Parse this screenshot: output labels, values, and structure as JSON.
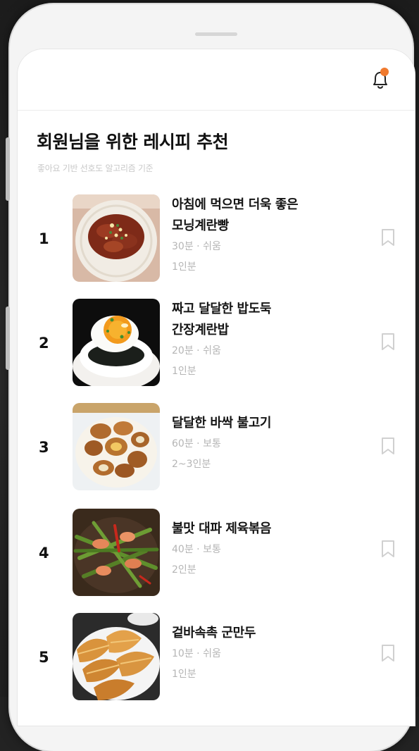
{
  "header": {
    "title": "회원님을 위한 레시피 추천",
    "subtitle": "좋아요 기반 선호도 알고리즘 기준",
    "accent_color": "#f07a2e",
    "icons": [
      "bell-icon"
    ]
  },
  "recipes": [
    {
      "rank": "1",
      "name": "아침에 먹으면 더욱 좋은\n모닝계란빵",
      "time": "30분",
      "level": "쉬움",
      "servings": "1인분",
      "image": "bulgogi-plate"
    },
    {
      "rank": "2",
      "name": "짜고 달달한 밥도둑\n간장계란밥",
      "time": "20분",
      "level": "쉬움",
      "servings": "1인분",
      "image": "egg-rice-bowl"
    },
    {
      "rank": "3",
      "name": "달달한 바싹 불고기",
      "time": "60분",
      "level": "보통",
      "servings": "2~3인분",
      "image": "braised-eggs"
    },
    {
      "rank": "4",
      "name": "불맛 대파 제육볶음",
      "time": "40분",
      "level": "보통",
      "servings": "2인분",
      "image": "stir-fry"
    },
    {
      "rank": "5",
      "name": "겉바속촉 군만두",
      "time": "10분",
      "level": "쉬움",
      "servings": "1인분",
      "image": "fried-dumplings"
    }
  ],
  "meta_separator": "·"
}
